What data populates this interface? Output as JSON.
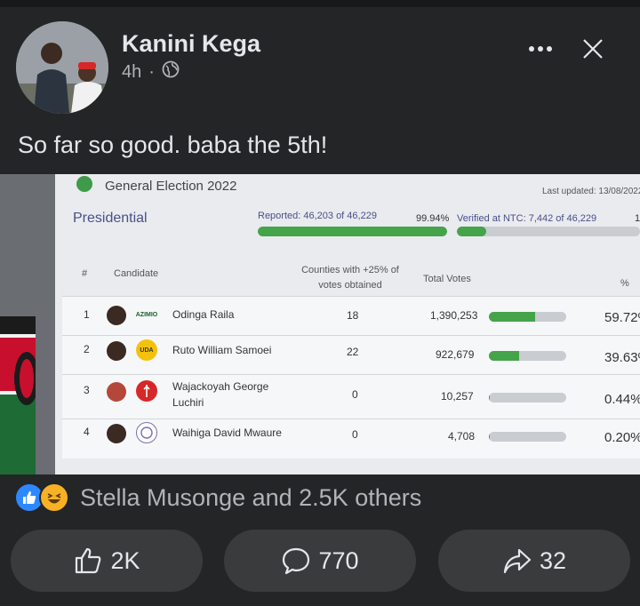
{
  "post": {
    "author": "Kanini Kega",
    "time": "4h",
    "privacy_icon": "globe-icon",
    "text": "So far so good. baba the 5th!"
  },
  "header_icons": [
    "more-icon",
    "close-icon"
  ],
  "screen": {
    "title": "General Election 2022",
    "last_updated": "Last updated: 13/08/2022",
    "section": "Presidential",
    "reported_text": "Reported: 46,203 of 46,229",
    "reported_percent": "99.94%",
    "reported_fraction": 0.9994,
    "verified_text": "Verified at NTC: 7,442 of 46,229",
    "verified_fraction": 0.161,
    "next_col": "1",
    "columns": {
      "num": "#",
      "candidate": "Candidate",
      "counties": "Counties with +25% of votes obtained",
      "total": "Total Votes",
      "pct": "%"
    },
    "rows": [
      {
        "num": "1",
        "name": "Odinga Raila",
        "party": "AZIMIO",
        "counties": "18",
        "votes": "1,390,253",
        "pct": "59.72%",
        "share": 0.5972
      },
      {
        "num": "2",
        "name": "Ruto William Samoei",
        "party": "UDA",
        "counties": "22",
        "votes": "922,679",
        "pct": "39.63%",
        "share": 0.3963
      },
      {
        "num": "3",
        "name": "Wajackoyah George Luchiri",
        "party": "",
        "counties": "0",
        "votes": "10,257",
        "pct": "0.44%",
        "share": 0.0044
      },
      {
        "num": "4",
        "name": "Waihiga David Mwaure",
        "party": "",
        "counties": "0",
        "votes": "4,708",
        "pct": "0.20%",
        "share": 0.002
      }
    ]
  },
  "reactions": {
    "icons": [
      "like-icon",
      "haha-icon"
    ],
    "text": "Stella Musonge and 2.5K others"
  },
  "actions": {
    "like_count": "2K",
    "comment_count": "770",
    "share_count": "32"
  }
}
